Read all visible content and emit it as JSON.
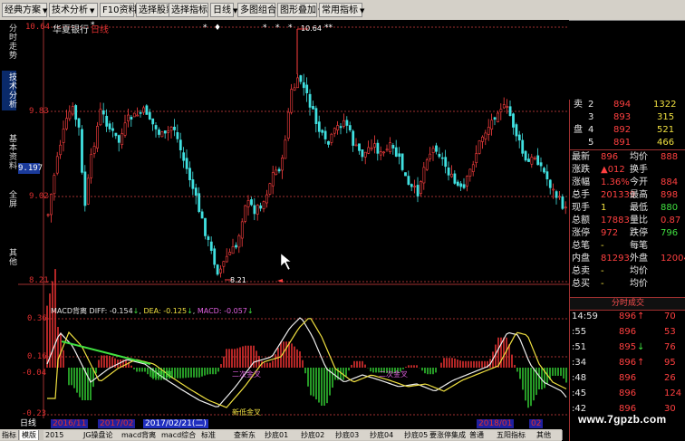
{
  "toolbar": {
    "buttons": [
      "经典方案",
      "技术分析",
      "F10资料",
      "选择股票",
      "选择指标",
      "日线",
      "多图组合",
      "图形叠加",
      "常用指标"
    ]
  },
  "left_tabs": [
    "分时走势",
    "技术分析",
    "基本资料",
    "全屏",
    "其他"
  ],
  "stock": {
    "name": "华夏银行",
    "period": "日线"
  },
  "y_axis_price": {
    "top": "10.64",
    "v1": "9.83",
    "v2": "9.02",
    "bottom": "8.21",
    "current": "9.197"
  },
  "y_axis_macd": {
    "top": "0.36",
    "v1": "0.16",
    "v2": "-0.04",
    "bottom": "-0.23"
  },
  "price_annotations": {
    "high": "10.64",
    "low": "8.21",
    "marks": [
      "*",
      "♦",
      "*",
      "*",
      "*",
      "**"
    ]
  },
  "macd_legend": {
    "name": "MACD背离",
    "diff_label": "DIFF:",
    "diff_value": "-0.154",
    "dea_label": "DEA:",
    "dea_value": "-0.125",
    "macd_label": "MACD:",
    "macd_value": "-0.057",
    "arrow": "↓"
  },
  "macd_signals": {
    "divergence": "顶背离",
    "second_golden_cross_1": "二次金叉",
    "second_golden_cross_2": "二次金叉",
    "new_low_golden_cross": "新低金叉"
  },
  "dates": {
    "period_label": "日线",
    "d1": "2016/11",
    "d2": "2017/02",
    "d3": "2017/02/21(二)",
    "d4": "2018/01",
    "d5": "02"
  },
  "bottom_tabs": [
    "指标",
    "模版",
    "2015",
    "JG操盘论",
    "macd背离",
    "macd综合",
    "标准",
    "查新东",
    "抄底01",
    "抄底02",
    "抄底03",
    "抄底04",
    "抄底05",
    "要涨停集成",
    "普通",
    "五阳指标",
    "其他"
  ],
  "right_panel": {
    "order_book": [
      {
        "side": "卖",
        "level": "2",
        "price": "894",
        "vol": "1322"
      },
      {
        "side": "",
        "level": "3",
        "price": "893",
        "vol": "315"
      },
      {
        "side": "盘",
        "level": "4",
        "price": "892",
        "vol": "521"
      },
      {
        "side": "",
        "level": "5",
        "price": "891",
        "vol": "466"
      }
    ],
    "stats": [
      {
        "l1": "最新",
        "v1": "896",
        "l2": "均价",
        "v2": "888"
      },
      {
        "l1": "涨跌",
        "v1": "▲012",
        "l2": "换手",
        "v2": ""
      },
      {
        "l1": "涨幅",
        "v1": "1.36%",
        "l2": "今开",
        "v2": "884"
      },
      {
        "l1": "总手",
        "v1": "201339",
        "l2": "最高",
        "v2": "898"
      },
      {
        "l1": "现手",
        "v1": "1",
        "l2": "最低",
        "v2": "880"
      },
      {
        "l1": "总额",
        "v1": "17883",
        "l2": "量比",
        "v2": "0.87"
      },
      {
        "l1": "涨停",
        "v1": "972",
        "l2": "跌停",
        "v2": "796"
      },
      {
        "l1": "总笔",
        "v1": "-",
        "l2": "每笔",
        "v2": ""
      },
      {
        "l1": "内盘",
        "v1": "81293",
        "l2": "外盘",
        "v2": "120046"
      },
      {
        "l1": "总卖",
        "v1": "-",
        "l2": "均价",
        "v2": ""
      },
      {
        "l1": "总买",
        "v1": "-",
        "l2": "均价",
        "v2": ""
      }
    ],
    "trades_header": "分时成交",
    "trades": [
      {
        "time": "14:59",
        "price": "896",
        "dir": "↑",
        "vol": "70"
      },
      {
        "time": ":55",
        "price": "896",
        "dir": "",
        "vol": "53"
      },
      {
        "time": ":51",
        "price": "895",
        "dir": "↓",
        "vol": "76"
      },
      {
        "time": ":34",
        "price": "896",
        "dir": "↑",
        "vol": "95"
      },
      {
        "time": ":48",
        "price": "896",
        "dir": "",
        "vol": "26"
      },
      {
        "time": ":45",
        "price": "896",
        "dir": "",
        "vol": "124"
      },
      {
        "time": ":42",
        "price": "896",
        "dir": "",
        "vol": "30"
      }
    ]
  },
  "watermark": "www.7gpzb.com",
  "colors": {
    "up": "#ff4040",
    "down": "#40e0e0",
    "macd_pos": "#e03030",
    "macd_neg": "#30c030",
    "diff": "#f0f0f0",
    "dea": "#f0e040",
    "divergence_line": "#40e040",
    "axis": "#a03030"
  }
}
